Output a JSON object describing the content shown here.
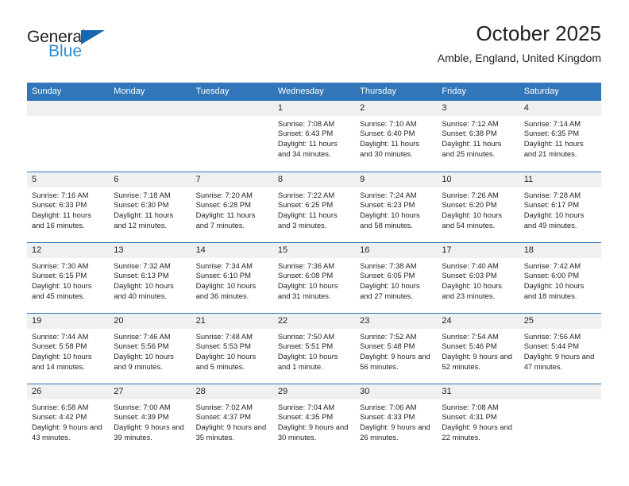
{
  "brand": {
    "name_part1": "General",
    "name_part2": "Blue",
    "triangle_color": "#1668b0",
    "blue_color": "#2a8fd4"
  },
  "header": {
    "title": "October 2025",
    "subtitle": "Amble, England, United Kingdom"
  },
  "theme": {
    "header_blue": "#3176b8",
    "day_band_gray": "#f0f0f0",
    "text": "#231f20"
  },
  "weekdays": [
    "Sunday",
    "Monday",
    "Tuesday",
    "Wednesday",
    "Thursday",
    "Friday",
    "Saturday"
  ],
  "weeks": [
    [
      {
        "day": "",
        "sunrise": "",
        "sunset": "",
        "daylight": ""
      },
      {
        "day": "",
        "sunrise": "",
        "sunset": "",
        "daylight": ""
      },
      {
        "day": "",
        "sunrise": "",
        "sunset": "",
        "daylight": ""
      },
      {
        "day": "1",
        "sunrise": "Sunrise: 7:08 AM",
        "sunset": "Sunset: 6:43 PM",
        "daylight": "Daylight: 11 hours and 34 minutes."
      },
      {
        "day": "2",
        "sunrise": "Sunrise: 7:10 AM",
        "sunset": "Sunset: 6:40 PM",
        "daylight": "Daylight: 11 hours and 30 minutes."
      },
      {
        "day": "3",
        "sunrise": "Sunrise: 7:12 AM",
        "sunset": "Sunset: 6:38 PM",
        "daylight": "Daylight: 11 hours and 25 minutes."
      },
      {
        "day": "4",
        "sunrise": "Sunrise: 7:14 AM",
        "sunset": "Sunset: 6:35 PM",
        "daylight": "Daylight: 11 hours and 21 minutes."
      }
    ],
    [
      {
        "day": "5",
        "sunrise": "Sunrise: 7:16 AM",
        "sunset": "Sunset: 6:33 PM",
        "daylight": "Daylight: 11 hours and 16 minutes."
      },
      {
        "day": "6",
        "sunrise": "Sunrise: 7:18 AM",
        "sunset": "Sunset: 6:30 PM",
        "daylight": "Daylight: 11 hours and 12 minutes."
      },
      {
        "day": "7",
        "sunrise": "Sunrise: 7:20 AM",
        "sunset": "Sunset: 6:28 PM",
        "daylight": "Daylight: 11 hours and 7 minutes."
      },
      {
        "day": "8",
        "sunrise": "Sunrise: 7:22 AM",
        "sunset": "Sunset: 6:25 PM",
        "daylight": "Daylight: 11 hours and 3 minutes."
      },
      {
        "day": "9",
        "sunrise": "Sunrise: 7:24 AM",
        "sunset": "Sunset: 6:23 PM",
        "daylight": "Daylight: 10 hours and 58 minutes."
      },
      {
        "day": "10",
        "sunrise": "Sunrise: 7:26 AM",
        "sunset": "Sunset: 6:20 PM",
        "daylight": "Daylight: 10 hours and 54 minutes."
      },
      {
        "day": "11",
        "sunrise": "Sunrise: 7:28 AM",
        "sunset": "Sunset: 6:17 PM",
        "daylight": "Daylight: 10 hours and 49 minutes."
      }
    ],
    [
      {
        "day": "12",
        "sunrise": "Sunrise: 7:30 AM",
        "sunset": "Sunset: 6:15 PM",
        "daylight": "Daylight: 10 hours and 45 minutes."
      },
      {
        "day": "13",
        "sunrise": "Sunrise: 7:32 AM",
        "sunset": "Sunset: 6:13 PM",
        "daylight": "Daylight: 10 hours and 40 minutes."
      },
      {
        "day": "14",
        "sunrise": "Sunrise: 7:34 AM",
        "sunset": "Sunset: 6:10 PM",
        "daylight": "Daylight: 10 hours and 36 minutes."
      },
      {
        "day": "15",
        "sunrise": "Sunrise: 7:36 AM",
        "sunset": "Sunset: 6:08 PM",
        "daylight": "Daylight: 10 hours and 31 minutes."
      },
      {
        "day": "16",
        "sunrise": "Sunrise: 7:38 AM",
        "sunset": "Sunset: 6:05 PM",
        "daylight": "Daylight: 10 hours and 27 minutes."
      },
      {
        "day": "17",
        "sunrise": "Sunrise: 7:40 AM",
        "sunset": "Sunset: 6:03 PM",
        "daylight": "Daylight: 10 hours and 23 minutes."
      },
      {
        "day": "18",
        "sunrise": "Sunrise: 7:42 AM",
        "sunset": "Sunset: 6:00 PM",
        "daylight": "Daylight: 10 hours and 18 minutes."
      }
    ],
    [
      {
        "day": "19",
        "sunrise": "Sunrise: 7:44 AM",
        "sunset": "Sunset: 5:58 PM",
        "daylight": "Daylight: 10 hours and 14 minutes."
      },
      {
        "day": "20",
        "sunrise": "Sunrise: 7:46 AM",
        "sunset": "Sunset: 5:56 PM",
        "daylight": "Daylight: 10 hours and 9 minutes."
      },
      {
        "day": "21",
        "sunrise": "Sunrise: 7:48 AM",
        "sunset": "Sunset: 5:53 PM",
        "daylight": "Daylight: 10 hours and 5 minutes."
      },
      {
        "day": "22",
        "sunrise": "Sunrise: 7:50 AM",
        "sunset": "Sunset: 5:51 PM",
        "daylight": "Daylight: 10 hours and 1 minute."
      },
      {
        "day": "23",
        "sunrise": "Sunrise: 7:52 AM",
        "sunset": "Sunset: 5:48 PM",
        "daylight": "Daylight: 9 hours and 56 minutes."
      },
      {
        "day": "24",
        "sunrise": "Sunrise: 7:54 AM",
        "sunset": "Sunset: 5:46 PM",
        "daylight": "Daylight: 9 hours and 52 minutes."
      },
      {
        "day": "25",
        "sunrise": "Sunrise: 7:56 AM",
        "sunset": "Sunset: 5:44 PM",
        "daylight": "Daylight: 9 hours and 47 minutes."
      }
    ],
    [
      {
        "day": "26",
        "sunrise": "Sunrise: 6:58 AM",
        "sunset": "Sunset: 4:42 PM",
        "daylight": "Daylight: 9 hours and 43 minutes."
      },
      {
        "day": "27",
        "sunrise": "Sunrise: 7:00 AM",
        "sunset": "Sunset: 4:39 PM",
        "daylight": "Daylight: 9 hours and 39 minutes."
      },
      {
        "day": "28",
        "sunrise": "Sunrise: 7:02 AM",
        "sunset": "Sunset: 4:37 PM",
        "daylight": "Daylight: 9 hours and 35 minutes."
      },
      {
        "day": "29",
        "sunrise": "Sunrise: 7:04 AM",
        "sunset": "Sunset: 4:35 PM",
        "daylight": "Daylight: 9 hours and 30 minutes."
      },
      {
        "day": "30",
        "sunrise": "Sunrise: 7:06 AM",
        "sunset": "Sunset: 4:33 PM",
        "daylight": "Daylight: 9 hours and 26 minutes."
      },
      {
        "day": "31",
        "sunrise": "Sunrise: 7:08 AM",
        "sunset": "Sunset: 4:31 PM",
        "daylight": "Daylight: 9 hours and 22 minutes."
      },
      {
        "day": "",
        "sunrise": "",
        "sunset": "",
        "daylight": ""
      }
    ]
  ]
}
